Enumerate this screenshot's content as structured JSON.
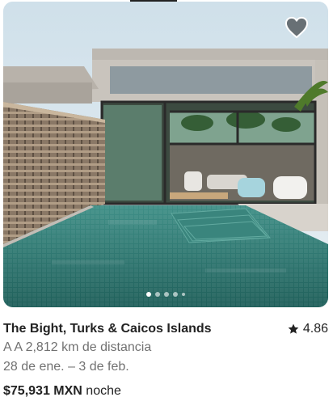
{
  "listing": {
    "title": "The Bight, Turks & Caicos Islands",
    "rating": "4.86",
    "distance": "A A 2,812 km de distancia",
    "dates": "28 de ene. – 3 de feb.",
    "price": "$75,931 MXN",
    "price_unit": "noche",
    "favorite_icon": "heart-icon",
    "rating_icon": "star-icon",
    "photo_description": "Modern concrete villa with infinity pool, glass walls and tropical palms"
  },
  "carousel": {
    "total_dots": 5,
    "active_index": 0
  },
  "colors": {
    "text_primary": "#222222",
    "text_secondary": "#717171",
    "heart_fill": "rgba(0,0,0,0.5)"
  }
}
